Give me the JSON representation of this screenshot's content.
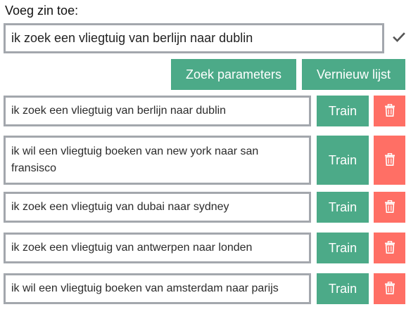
{
  "form": {
    "label": "Voeg zin toe:",
    "input_value": "ik zoek een vliegtuig van berlijn naar dublin",
    "confirm_icon": "check-icon"
  },
  "actions": {
    "search_params_label": "Zoek parameters",
    "refresh_list_label": "Vernieuw lijst"
  },
  "sentences": [
    {
      "text": "ik zoek een vliegtuig van berlijn naar dublin",
      "train_label": "Train",
      "delete_icon": "trash-icon"
    },
    {
      "text": "ik wil een vliegtuig boeken van new york naar san fransisco",
      "train_label": "Train",
      "delete_icon": "trash-icon"
    },
    {
      "text": "ik zoek een vliegtuig van dubai naar sydney",
      "train_label": "Train",
      "delete_icon": "trash-icon"
    },
    {
      "text": "ik zoek een vliegtuig van antwerpen naar londen",
      "train_label": "Train",
      "delete_icon": "trash-icon"
    },
    {
      "text": "ik wil een vliegtuig boeken van amsterdam naar parijs",
      "train_label": "Train",
      "delete_icon": "trash-icon"
    }
  ],
  "colors": {
    "primary": "#4caa88",
    "danger": "#ff6f65",
    "border": "#a3a7ad"
  }
}
